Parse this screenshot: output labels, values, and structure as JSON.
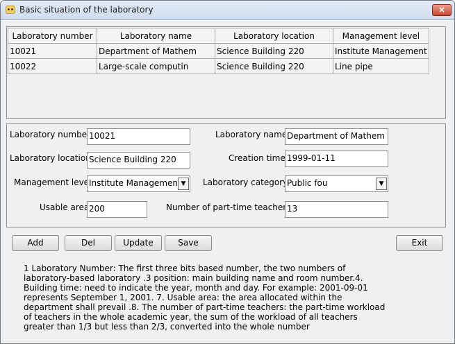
{
  "window": {
    "title": "Basic situation of the laboratory",
    "close_label": "×"
  },
  "grid": {
    "headers": [
      "Laboratory number",
      "Laboratory name",
      "Laboratory location",
      "Management level"
    ],
    "rows": [
      [
        "10021",
        "Department of Mathem",
        "Science Building 220",
        "Institute Management"
      ],
      [
        "10022",
        "Large-scale computin",
        "Science Building 220",
        "Line pipe"
      ]
    ]
  },
  "form": {
    "lab_number": {
      "label": "Laboratory number",
      "value": "10021"
    },
    "lab_name": {
      "label": "Laboratory name",
      "value": "Department of Mathem"
    },
    "lab_location": {
      "label": "Laboratory location",
      "value": "Science Building 220"
    },
    "creation_time": {
      "label": "Creation time",
      "value": "1999-01-11"
    },
    "management_level": {
      "label": "Management level",
      "value": "Institute Management"
    },
    "lab_category": {
      "label": "Laboratory category",
      "value": "Public fou"
    },
    "usable_area": {
      "label": "Usable area",
      "value": "200"
    },
    "part_time_teachers": {
      "label": "Number of part-time teachers",
      "value": "13"
    }
  },
  "buttons": {
    "add": "Add",
    "del": "Del",
    "update": "Update",
    "save": "Save",
    "exit": "Exit"
  },
  "note": "1 Laboratory Number: The first three bits based number, the two numbers of laboratory-based laboratory .3 position: main building name and room number.4. Building time: need to indicate the year, month and day. For example: 2001-09-01 represents September 1, 2001. 7. Usable area: the area allocated within the department shall prevail .8. The number of part-time teachers: the part-time workload of teachers in the whole academic year, the sum of the workload of all teachers greater than 1/3 but less than 2/3, converted into the whole number",
  "icons": {
    "window_icon": "app-icon",
    "combo_arrow": "chevron-down-icon"
  }
}
